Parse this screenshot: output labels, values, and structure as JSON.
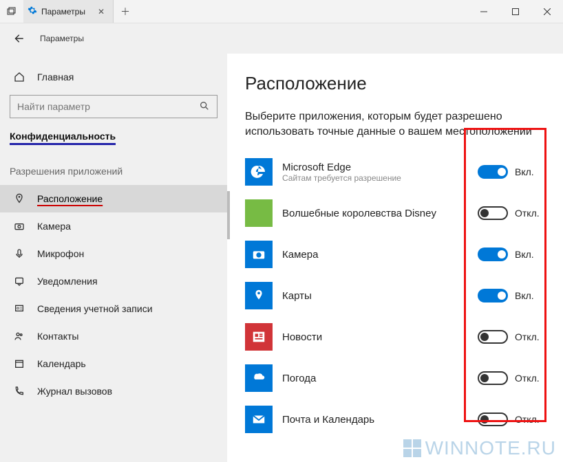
{
  "titlebar": {
    "tab_label": "Параметры",
    "app_title": "Параметры"
  },
  "sidebar": {
    "home": "Главная",
    "search_placeholder": "Найти параметр",
    "category": "Конфиденциальность",
    "group": "Разрешения приложений",
    "items": [
      {
        "label": "Расположение"
      },
      {
        "label": "Камера"
      },
      {
        "label": "Микрофон"
      },
      {
        "label": "Уведомления"
      },
      {
        "label": "Сведения учетной записи"
      },
      {
        "label": "Контакты"
      },
      {
        "label": "Календарь"
      },
      {
        "label": "Журнал вызовов"
      }
    ]
  },
  "main": {
    "heading": "Расположение",
    "lead": "Выберите приложения, которым будет разрешено использовать точные данные о вашем местоположении",
    "status_on": "Вкл.",
    "status_off": "Откл.",
    "apps": [
      {
        "name": "Microsoft Edge",
        "sub": "Сайтам требуется разрешение",
        "on": true,
        "icon": "edge"
      },
      {
        "name": "Волшебные королевства Disney",
        "sub": "",
        "on": false,
        "icon": "disney"
      },
      {
        "name": "Камера",
        "sub": "",
        "on": true,
        "icon": "camera"
      },
      {
        "name": "Карты",
        "sub": "",
        "on": true,
        "icon": "maps"
      },
      {
        "name": "Новости",
        "sub": "",
        "on": false,
        "icon": "news"
      },
      {
        "name": "Погода",
        "sub": "",
        "on": false,
        "icon": "weather"
      },
      {
        "name": "Почта и Календарь",
        "sub": "",
        "on": false,
        "icon": "mail"
      }
    ]
  },
  "watermark": "WINNOTE.RU"
}
